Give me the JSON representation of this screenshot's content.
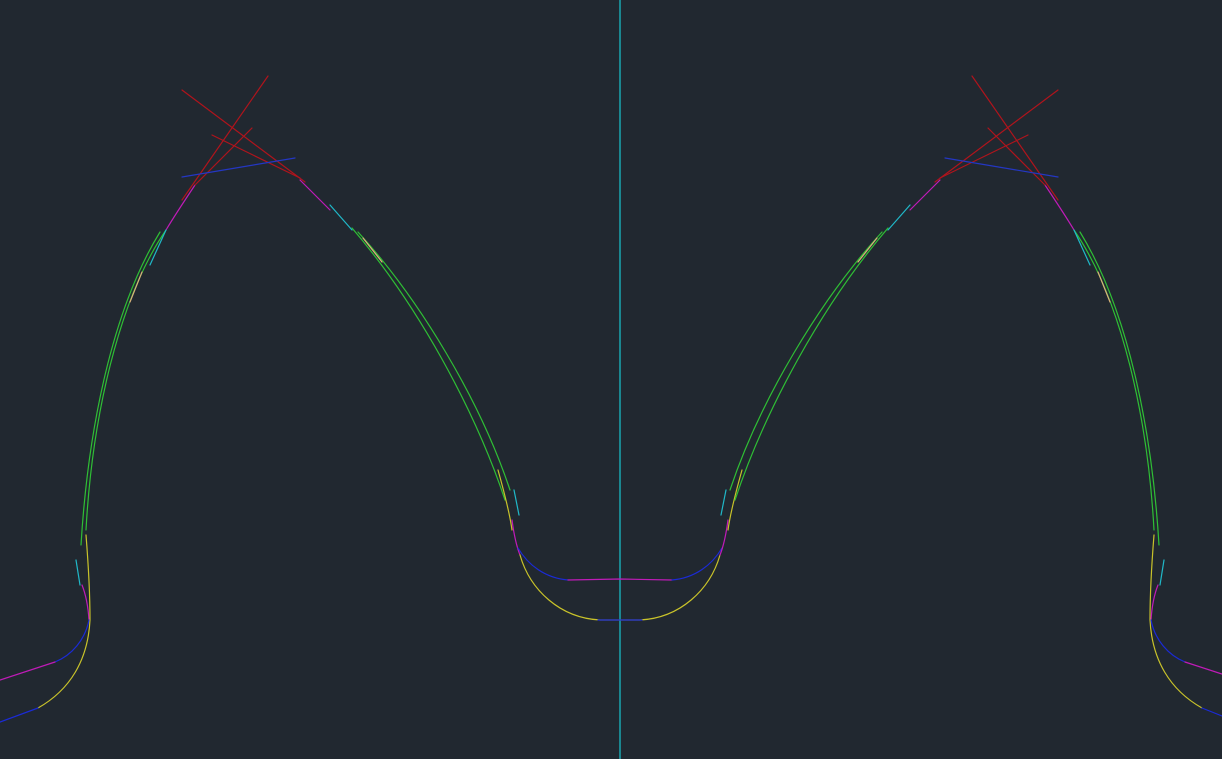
{
  "canvas": {
    "background": "#212830"
  },
  "colors": {
    "centerline": "#18c6d0",
    "flank": "#2fbf35",
    "fillet": "#c9c32a",
    "transition_magenta": "#c01bb8",
    "transition_blue": "#1b2bd6",
    "tip_red": "#b0141c",
    "tip_blue": "#2437c4",
    "marker_cyan": "#20b8c8",
    "marker_tan": "#d9b07a"
  },
  "drawing": {
    "type": "cad-gear-tooth-profile",
    "view": "2d-model-space",
    "teeth_visible": 2,
    "symmetric_about_centerline": true
  }
}
